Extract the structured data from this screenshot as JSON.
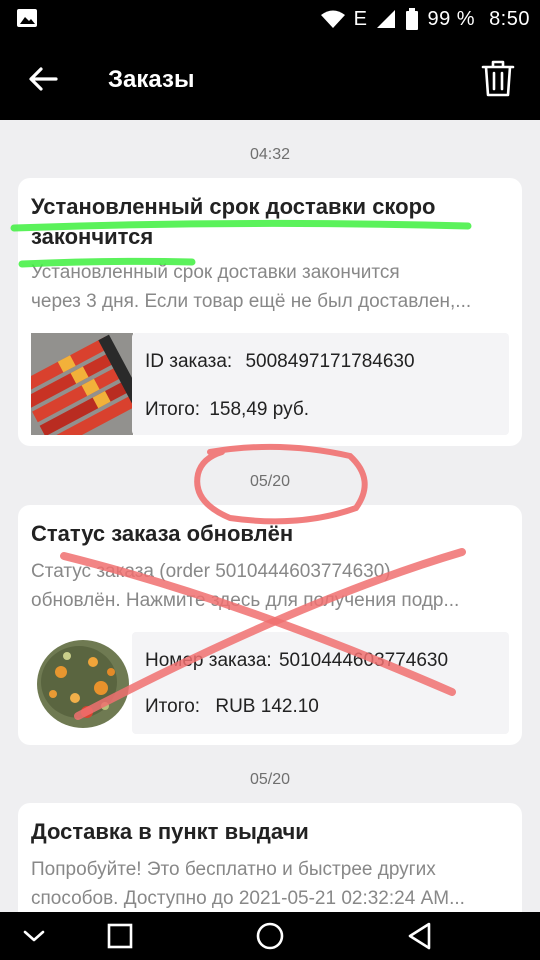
{
  "status_bar": {
    "network": "E",
    "battery": "99 %",
    "time": "8:50"
  },
  "header": {
    "title": "Заказы"
  },
  "messages": [
    {
      "date": "04:32",
      "title_line1": "Установленный срок доставки скоро",
      "title_line2": "закончится",
      "desc_line1": "Установленный срок доставки закончится",
      "desc_line2": "через 3 дня. Если товар ещё не был доставлен,...",
      "order_id_label": "ID заказа:",
      "order_id": "5008497171784630",
      "total_label": "Итого:",
      "total": "158,49 руб."
    },
    {
      "date": "05/20",
      "title_line1": "Статус заказа обновлён",
      "desc_line1": "Статус заказа (order 5010444603774630)",
      "desc_line2": "обновлён. Нажмите здесь для получения подр...",
      "order_id_label": "Номер заказа:",
      "order_id": "5010444603774630",
      "total_label": "Итого:",
      "total": "RUB 142.10"
    },
    {
      "date": "05/20",
      "title_line1": "Доставка в пункт выдачи",
      "desc_line1": "Попробуйте! Это бесплатно и быстрее других",
      "desc_line2": "способов. Доступно до 2021-05-21 02:32:24 AM..."
    }
  ],
  "colors": {
    "header_bg": "#000000",
    "page_bg": "#efeff1",
    "highlight": "#3ef03e",
    "annotation": "#f07070"
  }
}
